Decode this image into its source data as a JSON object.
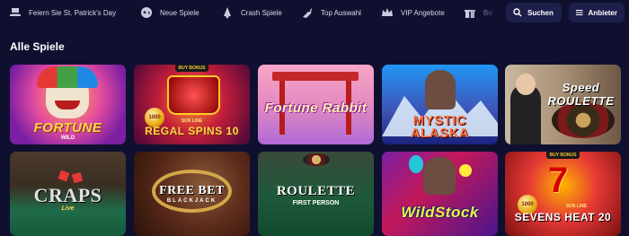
{
  "nav": {
    "items": [
      {
        "label": "Feiern Sie St. Patrick's Day",
        "icon": "hat-icon"
      },
      {
        "label": "Neue Spiele",
        "icon": "gamepad-icon"
      },
      {
        "label": "Crash Spiele",
        "icon": "rocket-icon"
      },
      {
        "label": "Top Auswahl",
        "icon": "rocket-star-icon"
      },
      {
        "label": "VIP Angebote",
        "icon": "crown-icon"
      },
      {
        "label": "Bo",
        "icon": "gift-icon"
      }
    ],
    "search_label": "Suchen",
    "providers_label": "Anbieter"
  },
  "section_title": "Alle Spiele",
  "games": [
    {
      "title": "FORTUNE",
      "subtitle": "WILD"
    },
    {
      "title": "REGAL SPINS 10",
      "subtitle": "SUN LINE",
      "badge": "BUY BONUS",
      "coin": "1000"
    },
    {
      "title": "Fortune Rabbit",
      "subtitle": ""
    },
    {
      "title": "MYSTIC ALASKA",
      "subtitle": ""
    },
    {
      "title": "Speed ROULETTE",
      "subtitle": ""
    },
    {
      "title": "CRAPS",
      "subtitle": "Live"
    },
    {
      "title": "FREE BET",
      "subtitle": "BLACKJACK"
    },
    {
      "title": "ROULETTE",
      "subtitle": "FIRST PERSON"
    },
    {
      "title": "WildStock",
      "subtitle": ""
    },
    {
      "title": "SEVENS HEAT 20",
      "subtitle": "SUN LINE",
      "badge": "BUY BONUS",
      "coin": "1000"
    }
  ],
  "colors": {
    "background": "#0f1030",
    "button": "#1d1f4a",
    "nav_text": "#d7d9ea"
  }
}
